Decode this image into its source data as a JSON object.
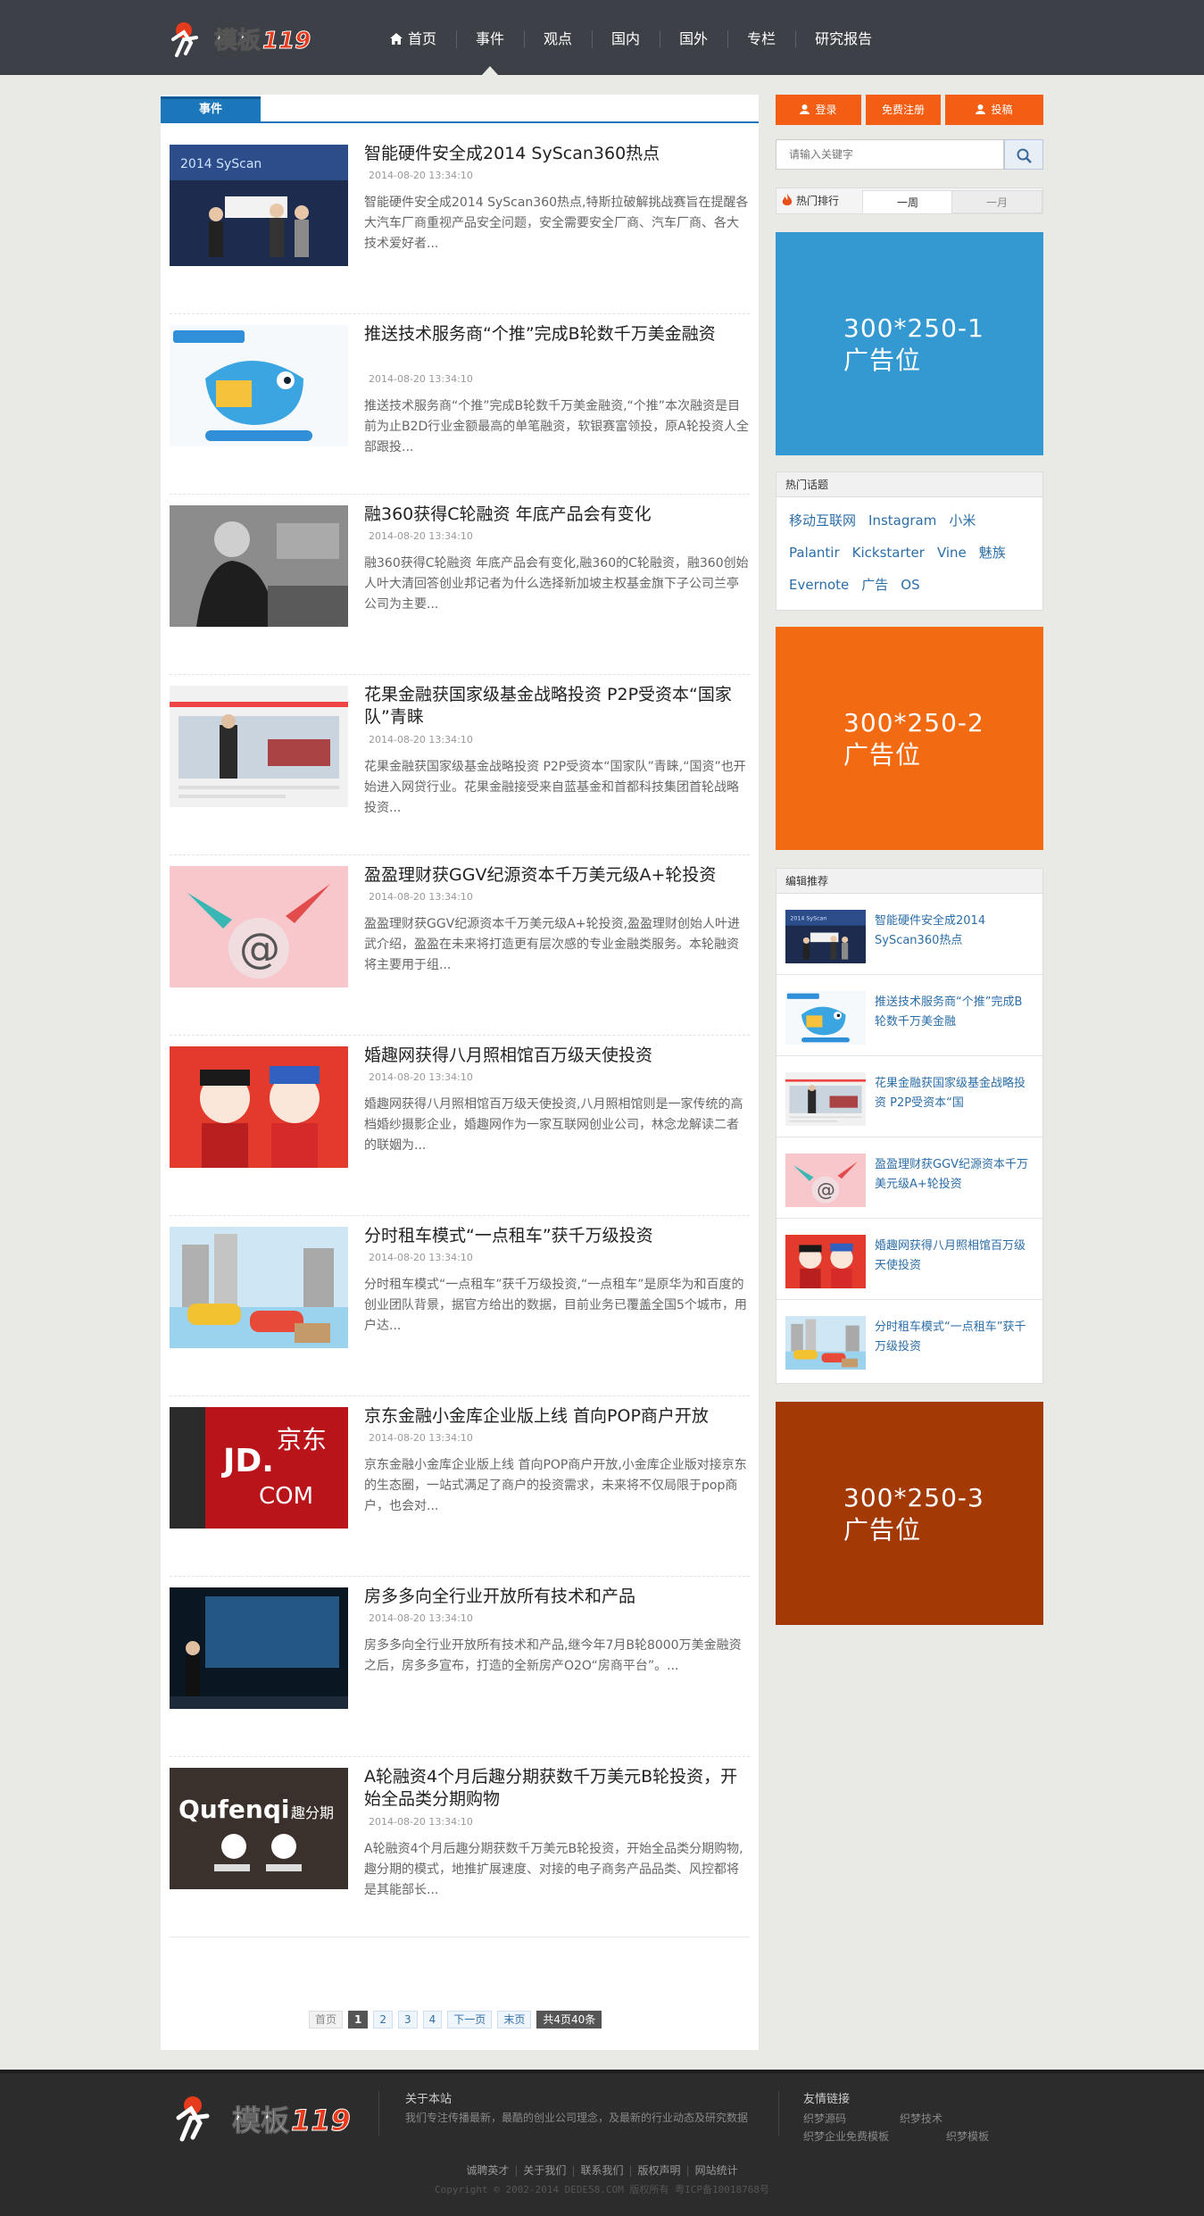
{
  "colors": {
    "header_bg": "#3d4046",
    "accent_blue": "#1b77b9",
    "accent_orange": "#f35d14",
    "ad1": "#3498d1",
    "ad2": "#f26a12",
    "ad3": "#a33a06",
    "link_blue": "#2b6ea8"
  },
  "site": {
    "logo_text": "模板119"
  },
  "nav": {
    "items": [
      {
        "label": "首页",
        "icon": "home-icon"
      },
      {
        "label": "事件"
      },
      {
        "label": "观点"
      },
      {
        "label": "国内"
      },
      {
        "label": "国外"
      },
      {
        "label": "专栏"
      },
      {
        "label": "研究报告"
      }
    ],
    "active_index": 1
  },
  "main": {
    "tab_label": "事件",
    "articles": [
      {
        "title": "智能硬件安全成2014 SyScan360热点",
        "date": "2014-08-20 13:34:10",
        "summary": "智能硬件安全成2014 SyScan360热点,特斯拉破解挑战赛旨在提醒各大汽车厂商重视产品安全问题，安全需要安全厂商、汽车厂商、各大技术爱好者..."
      },
      {
        "title": "推送技术服务商“个推”完成B轮数千万美金融资",
        "date": "2014-08-20 13:34:10",
        "summary": "推送技术服务商“个推”完成B轮数千万美金融资,“个推”本次融资是目前为止B2D行业金额最高的单笔融资，软银赛富领投，原A轮投资人全部跟投..."
      },
      {
        "title": "融360获得C轮融资 年底产品会有变化",
        "date": "2014-08-20 13:34:10",
        "summary": "融360获得C轮融资 年底产品会有变化,融360的C轮融资，融360创始人叶大清回答创业邦记者为什么选择新加坡主权基金旗下子公司兰亭公司为主要..."
      },
      {
        "title": "花果金融获国家级基金战略投资 P2P受资本“国家队”青睐",
        "date": "2014-08-20 13:34:10",
        "summary": "花果金融获国家级基金战略投资 P2P受资本“国家队”青睐,“国资”也开始进入网贷行业。花果金融接受来自蓝基金和首都科技集团首轮战略投资..."
      },
      {
        "title": "盈盈理财获GGV纪源资本千万美元级A+轮投资",
        "date": "2014-08-20 13:34:10",
        "summary": "盈盈理财获GGV纪源资本千万美元级A+轮投资,盈盈理财创始人叶进武介绍，盈盈在未来将打造更有层次感的专业金融类服务。本轮融资将主要用于组..."
      },
      {
        "title": "婚趣网获得八月照相馆百万级天使投资",
        "date": "2014-08-20 13:34:10",
        "summary": "婚趣网获得八月照相馆百万级天使投资,八月照相馆则是一家传统的高档婚纱摄影企业，婚趣网作为一家互联网创业公司，林念龙解读二者的联姻为..."
      },
      {
        "title": "分时租车模式“一点租车”获千万级投资",
        "date": "2014-08-20 13:34:10",
        "summary": "分时租车模式“一点租车”获千万级投资,“一点租车”是原华为和百度的创业团队背景，据官方给出的数据，目前业务已覆盖全国5个城市，用户达..."
      },
      {
        "title": "京东金融小金库企业版上线 首向POP商户开放",
        "date": "2014-08-20 13:34:10",
        "summary": "京东金融小金库企业版上线 首向POP商户开放,小金库企业版对接京东的生态圈，一站式满足了商户的投资需求，未来将不仅局限于pop商户，也会对..."
      },
      {
        "title": "房多多向全行业开放所有技术和产品",
        "date": "2014-08-20 13:34:10",
        "summary": "房多多向全行业开放所有技术和产品,继今年7月B轮8000万美金融资之后，房多多宣布，打造的全新房产O2O“房商平台”。..."
      },
      {
        "title": "A轮融资4个月后趣分期获数千万美元B轮投资，开始全品类分期购物",
        "date": "2014-08-20 13:34:10",
        "summary": "A轮融资4个月后趣分期获数千万美元B轮投资，开始全品类分期购物,趣分期的模式，地推扩展速度、对接的电子商务产品品类、风控都将是其能部长..."
      }
    ],
    "pager": {
      "first": "首页",
      "pages": [
        "1",
        "2",
        "3",
        "4"
      ],
      "current": "1",
      "next": "下一页",
      "last": "末页",
      "total": "共4页40条"
    }
  },
  "sidebar": {
    "buttons": {
      "login": "登录",
      "register": "免费注册",
      "submit": "投稿"
    },
    "search": {
      "placeholder": "请输入关键字"
    },
    "hot_rank": {
      "label": "热门排行",
      "tab_week": "一周",
      "tab_month": "一月"
    },
    "ads": [
      {
        "line1": "300*250-1",
        "line2": "广告位"
      },
      {
        "line1": "300*250-2",
        "line2": "广告位"
      },
      {
        "line1": "300*250-3",
        "line2": "广告位"
      }
    ],
    "hot_topics": {
      "label": "热门话题",
      "tags": [
        "移动互联网",
        "Instagram",
        "小米",
        "Palantir",
        "Kickstarter",
        "Vine",
        "魅族",
        "Evernote",
        "广告",
        "OS"
      ]
    },
    "recommend": {
      "label": "编辑推荐",
      "items": [
        "智能硬件安全成2014 SyScan360热点",
        "推送技术服务商“个推”完成B轮数千万美金融",
        "花果金融获国家级基金战略投资 P2P受资本“国",
        "盈盈理财获GGV纪源资本千万美元级A+轮投资",
        "婚趣网获得八月照相馆百万级天使投资",
        "分时租车模式“一点租车”获千万级投资"
      ]
    }
  },
  "footer": {
    "about_title": "关于本站",
    "about_text": "我们专注传播最新，最酷的创业公司理念，及最新的行业动态及研究数据",
    "links_title": "友情链接",
    "links": [
      "织梦源码",
      "织梦技术",
      "织梦企业免费模板",
      "织梦模板"
    ],
    "bottom_links": [
      "诚聘英才",
      "关于我们",
      "联系我们",
      "版权声明",
      "网站统计"
    ],
    "copyright": "Copyright © 2002-2014 DEDE58.COM 版权所有 粤ICP备10018768号"
  }
}
